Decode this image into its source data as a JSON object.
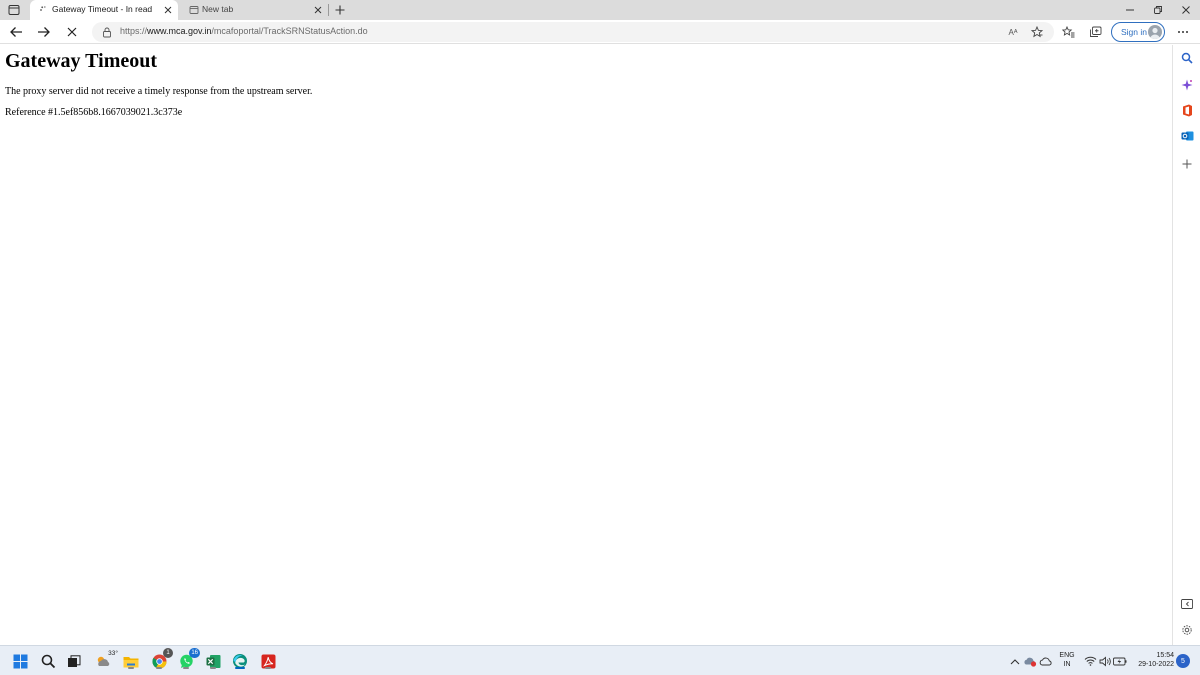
{
  "tabs": [
    {
      "title": "Gateway Timeout - In read",
      "active": true
    },
    {
      "title": "New tab",
      "active": false
    }
  ],
  "address": {
    "prefix": "https://",
    "host": "www.mca.gov.in",
    "path": "/mcafoportal/TrackSRNStatusAction.do"
  },
  "toolbar": {
    "signin_label": "Sign in",
    "read_aloud_glyph": "Aᴬ"
  },
  "page": {
    "heading": "Gateway Timeout",
    "message": "The proxy server did not receive a timely response from the upstream server.",
    "reference": "Reference #1.5ef856b8.1667039021.3c373e"
  },
  "sidebar_items": [
    "search-icon",
    "copilot-icon",
    "office-icon",
    "outlook-icon",
    "add-icon",
    "screen-icon",
    "settings-icon"
  ],
  "taskbar": {
    "weather_temp": "33°",
    "chrome_badge": "1",
    "whatsapp_badge": "16",
    "language_line1": "ENG",
    "language_line2": "IN",
    "time": "15:54",
    "date": "29-10-2022",
    "notification_count": "5"
  },
  "colors": {
    "accent": "#0067c0",
    "signin_blue": "#2f6fbf",
    "excel_green": "#1d7044",
    "acrobat_red": "#d7261f",
    "edge_teal": "#0b8f7c"
  }
}
